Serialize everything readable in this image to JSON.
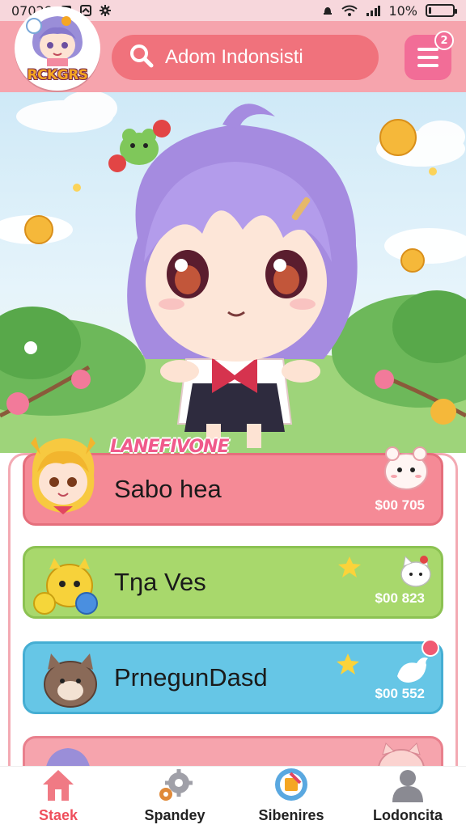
{
  "status_bar": {
    "time": "07028",
    "battery": "10%",
    "battery_level": 0.1
  },
  "header": {
    "logo_text": "RCKGRS",
    "search_placeholder": "Adom Indonsisti",
    "menu_badge": "2"
  },
  "section_label": "LANEFIVONE",
  "cards": [
    {
      "title": "Sabo hea",
      "price": "$00 705",
      "color": "#f58a96"
    },
    {
      "title": "Tŋa Ves",
      "price": "$00 823",
      "color": "#a8d86c"
    },
    {
      "title": "PrnegunDasd",
      "price": "$00 552",
      "color": "#66c6e6"
    },
    {
      "title": "",
      "price": "",
      "color": "#f6a4ad"
    }
  ],
  "bottom_nav": [
    {
      "label": "Staek",
      "icon": "home-icon",
      "active": true
    },
    {
      "label": "Spandey",
      "icon": "gears-icon",
      "active": false
    },
    {
      "label": "Sibenires",
      "icon": "badge-icon",
      "active": false
    },
    {
      "label": "Lodoncita",
      "icon": "person-icon",
      "active": false
    }
  ]
}
